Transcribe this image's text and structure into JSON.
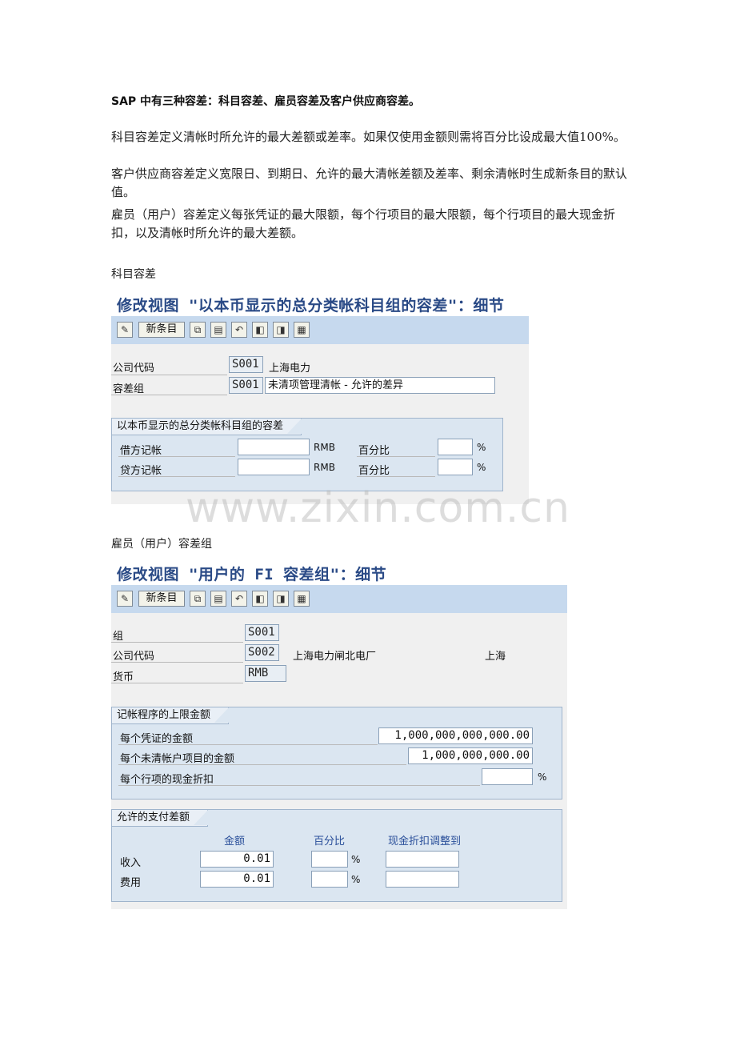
{
  "intro": {
    "headline": "SAP 中有三种容差：科目容差、雇员容差及客户供应商容差。",
    "paragraphs": [
      "科目容差定义清帐时所允许的最大差额或差率。如果仅使用金额则需将百分比设成最大值100%。",
      "客户供应商容差定义宽限日、到期日、允许的最大清帐差额及差率、剩余清帐时生成新条目的默认值。",
      "雇员（用户）容差定义每张凭证的最大限额，每个行项目的最大限额，每个行项目的最大现金折扣，以及清帐时所允许的最大差额。"
    ]
  },
  "section1": {
    "heading": "科目容差",
    "title": "修改视图 \"以本币显示的总分类帐科目组的容差\"：细节",
    "toolbar_new": "新条目",
    "fields": {
      "company_label": "公司代码",
      "company_code": "S001",
      "company_name": "上海电力",
      "group_label": "容差组",
      "group_code": "S001",
      "group_name": "未清项管理清帐 - 允许的差异"
    },
    "groupbox": {
      "title": "以本币显示的总分类帐科目组的容差",
      "rows": [
        {
          "label": "借方记帐",
          "amount": "",
          "currency": "RMB",
          "pct_label": "百分比",
          "pct": "",
          "pct_unit": "%"
        },
        {
          "label": "贷方记帐",
          "amount": "",
          "currency": "RMB",
          "pct_label": "百分比",
          "pct": "",
          "pct_unit": "%"
        }
      ]
    }
  },
  "watermark": "www.zixin.com.cn",
  "section2": {
    "heading": "雇员（用户）容差组",
    "title": "修改视图 \"用户的 FI 容差组\"：细节",
    "toolbar_new": "新条目",
    "fields": {
      "group_label": "组",
      "group_code": "S001",
      "company_label": "公司代码",
      "company_code": "S002",
      "company_name": "上海电力闸北电厂",
      "city": "上海",
      "currency_label": "货币",
      "currency_code": "RMB"
    },
    "limits": {
      "title": "记帐程序的上限金额",
      "rows": [
        {
          "label": "每个凭证的金额",
          "value": "1,000,000,000,000.00"
        },
        {
          "label": "每个未清帐户项目的金额",
          "value": "1,000,000,000.00"
        },
        {
          "label": "每个行项的现金折扣",
          "value": "",
          "unit": "%"
        }
      ]
    },
    "payment": {
      "title": "允许的支付差额",
      "col_amount": "金额",
      "col_pct": "百分比",
      "col_discount": "现金折扣调整到",
      "rows": [
        {
          "label": "收入",
          "amount": "0.01",
          "pct": "",
          "unit": "%",
          "discount": ""
        },
        {
          "label": "费用",
          "amount": "0.01",
          "pct": "",
          "unit": "%",
          "discount": ""
        }
      ]
    }
  }
}
